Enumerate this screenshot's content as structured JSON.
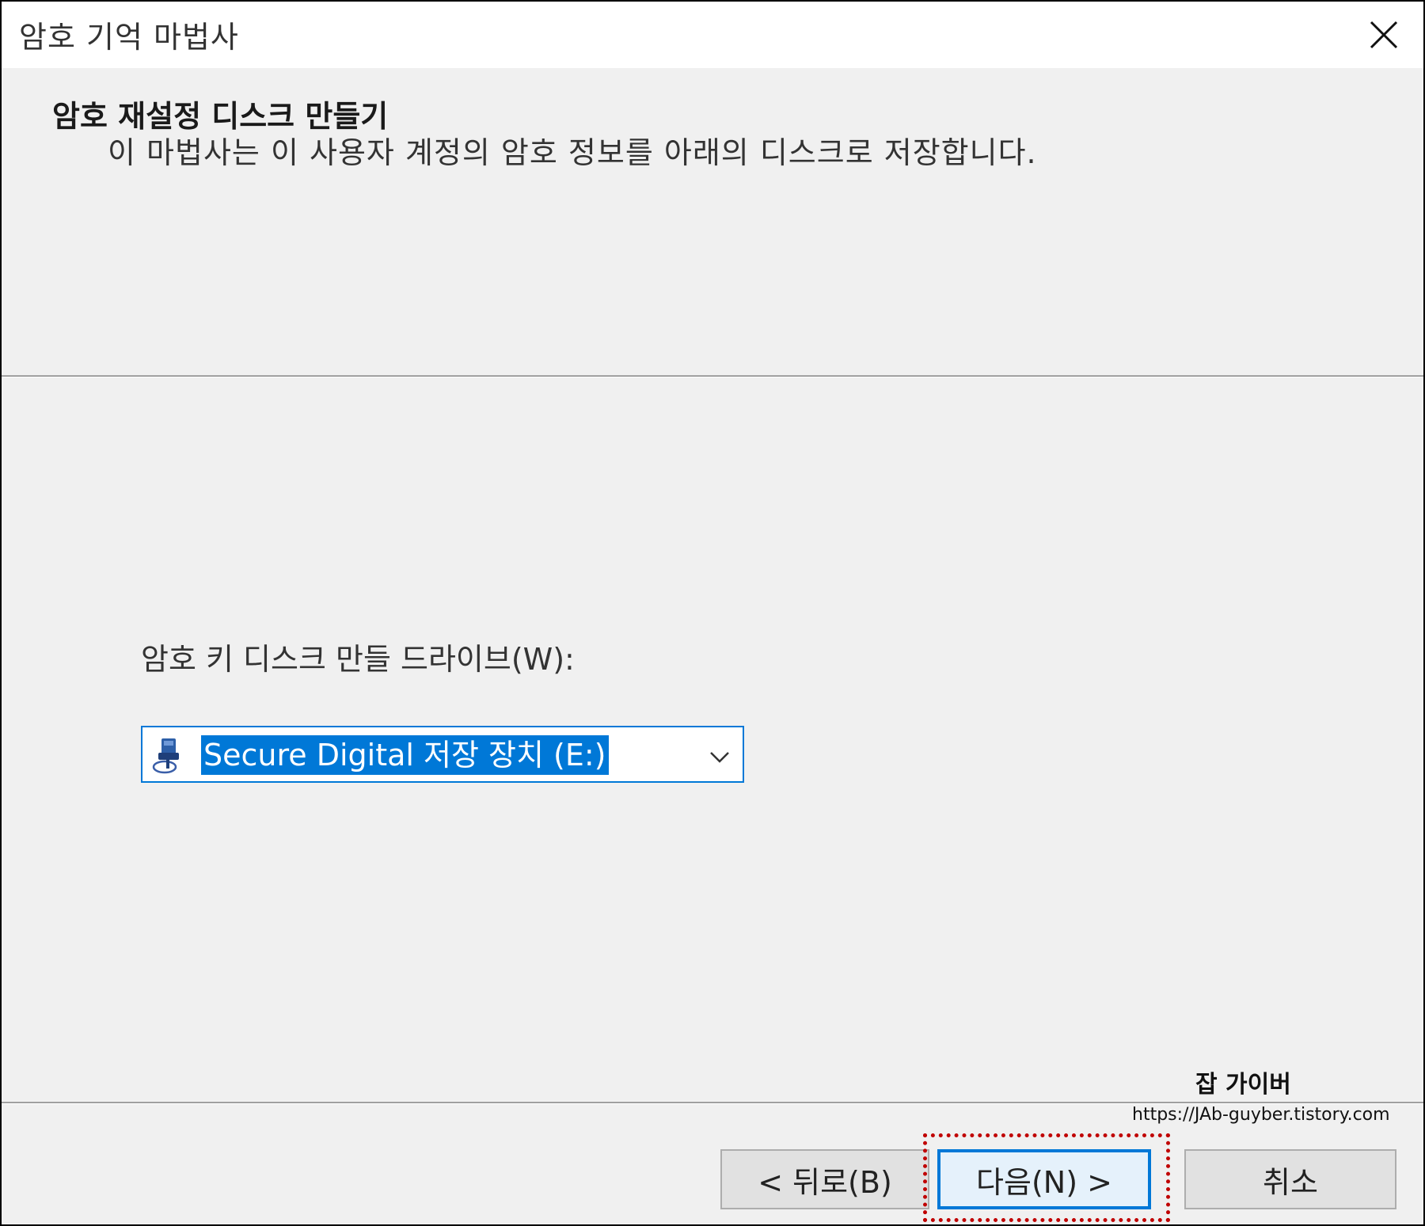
{
  "window": {
    "title": "암호 기억 마법사"
  },
  "header": {
    "title": "암호 재설정 디스크 만들기",
    "description": "이 마법사는 이 사용자 계정의 암호 정보를 아래의 디스크로 저장합니다."
  },
  "drive": {
    "label": "암호 키 디스크 만들 드라이브(W):",
    "selected_value": "Secure Digital 저장 장치 (E:)",
    "icon": "removable-drive-icon"
  },
  "watermark": {
    "name": "잡 가이버",
    "url": "https://JAb-guyber.tistory.com"
  },
  "buttons": {
    "back_label": "< 뒤로(B)",
    "next_label": "다음(N) >",
    "cancel_label": "취소"
  },
  "colors": {
    "accent": "#0078d7",
    "highlight_annotation": "#c00000",
    "dialog_background": "#f0f0f0"
  }
}
